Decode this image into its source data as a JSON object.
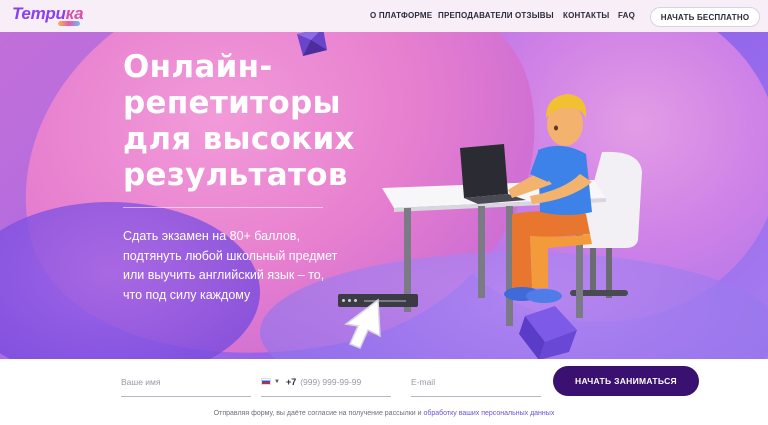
{
  "header": {
    "logo_text_left": "Тетри",
    "logo_text_right": "ка",
    "nav": [
      "О ПЛАТФОРМЕ",
      "ПРЕПОДАВАТЕЛИ",
      "ОТЗЫВЫ",
      "КОНТАКТЫ",
      "FAQ"
    ],
    "cta_label": "НАЧАТЬ БЕСПЛАТНО"
  },
  "hero": {
    "title_lines": [
      "Онлайн-",
      "репетиторы",
      "для высоких",
      "результатов"
    ],
    "subtitle_lines": [
      "Сдать экзамен на 80+ баллов,",
      "подтянуть любой школьный предмет",
      "или выучить английский язык – то,",
      "что под силу каждому"
    ]
  },
  "form": {
    "name_placeholder": "Ваше имя",
    "phone_code": "+7",
    "phone_placeholder": "(999) 999-99-99",
    "email_placeholder": "E-mail",
    "submit_label": "НАЧАТЬ ЗАНИМАТЬСЯ",
    "consent_text": "Отправляя форму, вы даёте согласие на получение рассылки и ",
    "consent_link": "обработку ваших персональных данных"
  },
  "colors": {
    "brand_dark": "#3a1170",
    "logo_purple": "#8a3ff0",
    "logo_pink": "#d84fa8",
    "hero_pink": "#e77fcf",
    "hero_violet": "#8f62ea"
  },
  "icons": [
    "flag-ru-icon",
    "chevron-down-icon",
    "cursor-icon",
    "player-bar-icon"
  ]
}
